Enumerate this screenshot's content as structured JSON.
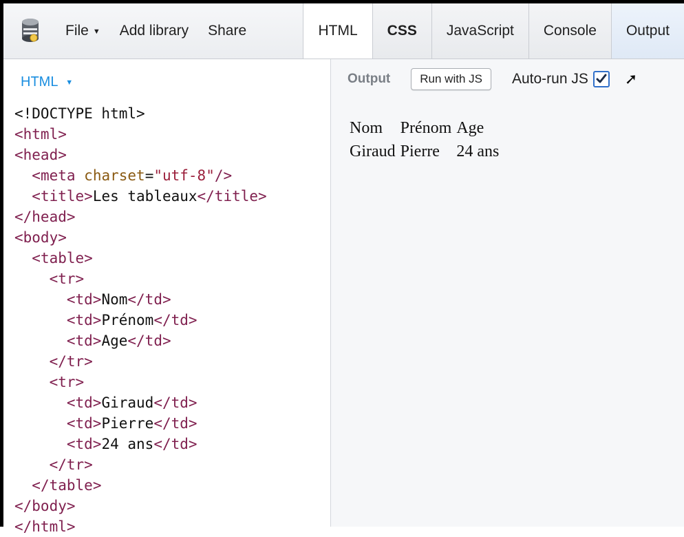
{
  "toolbar": {
    "logo_icon": "database-cylinder-icon",
    "file_label": "File",
    "add_library_label": "Add library",
    "share_label": "Share",
    "tabs": [
      {
        "label": "HTML",
        "state": "active"
      },
      {
        "label": "CSS",
        "state": "inactive"
      },
      {
        "label": "JavaScript",
        "state": "inactive"
      },
      {
        "label": "Console",
        "state": "inactive"
      },
      {
        "label": "Output",
        "state": "active"
      }
    ]
  },
  "editor": {
    "language_label": "HTML",
    "code_lines": [
      "<!DOCTYPE html>",
      "<html>",
      "<head>",
      "  <meta charset=\"utf-8\"/>",
      "  <title>Les tableaux</title>",
      "</head>",
      "<body>",
      "  <table>",
      "    <tr>",
      "      <td>Nom</td>",
      "      <td>Prénom</td>",
      "      <td>Age</td>",
      "    </tr>",
      "    <tr>",
      "      <td>Giraud</td>",
      "      <td>Pierre</td>",
      "      <td>24 ans</td>",
      "    </tr>",
      "  </table>",
      "</body>",
      "</html>"
    ]
  },
  "output": {
    "label": "Output",
    "run_button_label": "Run with JS",
    "auto_run_label": "Auto-run JS",
    "auto_run_checked": true,
    "popout_icon": "arrow-up-right-icon",
    "table_rows": [
      [
        "Nom",
        "Prénom",
        "Age"
      ],
      [
        "Giraud",
        "Pierre",
        "24 ans"
      ]
    ]
  },
  "colors": {
    "accent_blue": "#1a8ee0",
    "tag_color": "#7f1f4e",
    "attr_color": "#8a5a12",
    "string_color": "#9b1f3b"
  }
}
